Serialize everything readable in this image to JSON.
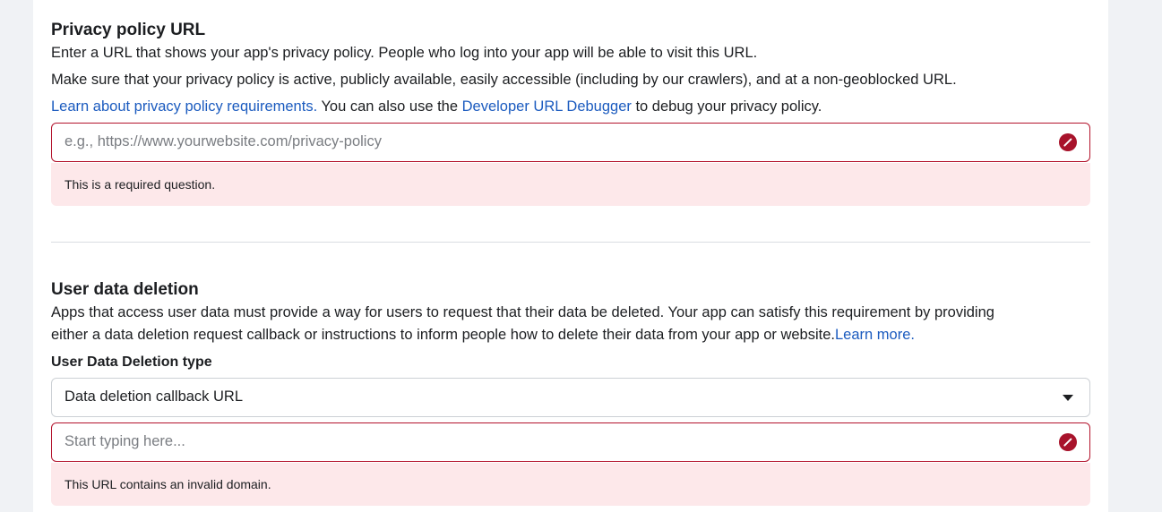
{
  "privacy": {
    "title": "Privacy policy URL",
    "desc1": "Enter a URL that shows your app's privacy policy. People who log into your app will be able to visit this URL.",
    "desc2": "Make sure that your privacy policy is active, publicly available, easily accessible (including by our crawlers), and at a non-geoblocked URL.",
    "link1": "Learn about privacy policy requirements.",
    "mid_text": " You can also use the ",
    "link2": "Developer URL Debugger",
    "end_text": " to debug your privacy policy.",
    "input_placeholder": "e.g., https://www.yourwebsite.com/privacy-policy",
    "input_value": "",
    "error": "This is a required question."
  },
  "deletion": {
    "title": "User data deletion",
    "desc_line1": "Apps that access user data must provide a way for users to request that their data be deleted. Your app can satisfy this requirement by providing",
    "desc_line2": "either a data deletion request callback or instructions to inform people how to delete their data from your app or website.",
    "learn_more": "Learn more",
    "period": ".",
    "type_label": "User Data Deletion type",
    "type_selected": "Data deletion callback URL",
    "input_placeholder": "Start typing here...",
    "input_value": "",
    "error": "This URL contains an invalid domain."
  },
  "colors": {
    "link": "#1b5bbf",
    "error_border": "#b3132c",
    "error_bg": "#fde8ea"
  },
  "icons": {
    "error": "error-circle-icon",
    "dropdown": "caret-down-icon"
  }
}
